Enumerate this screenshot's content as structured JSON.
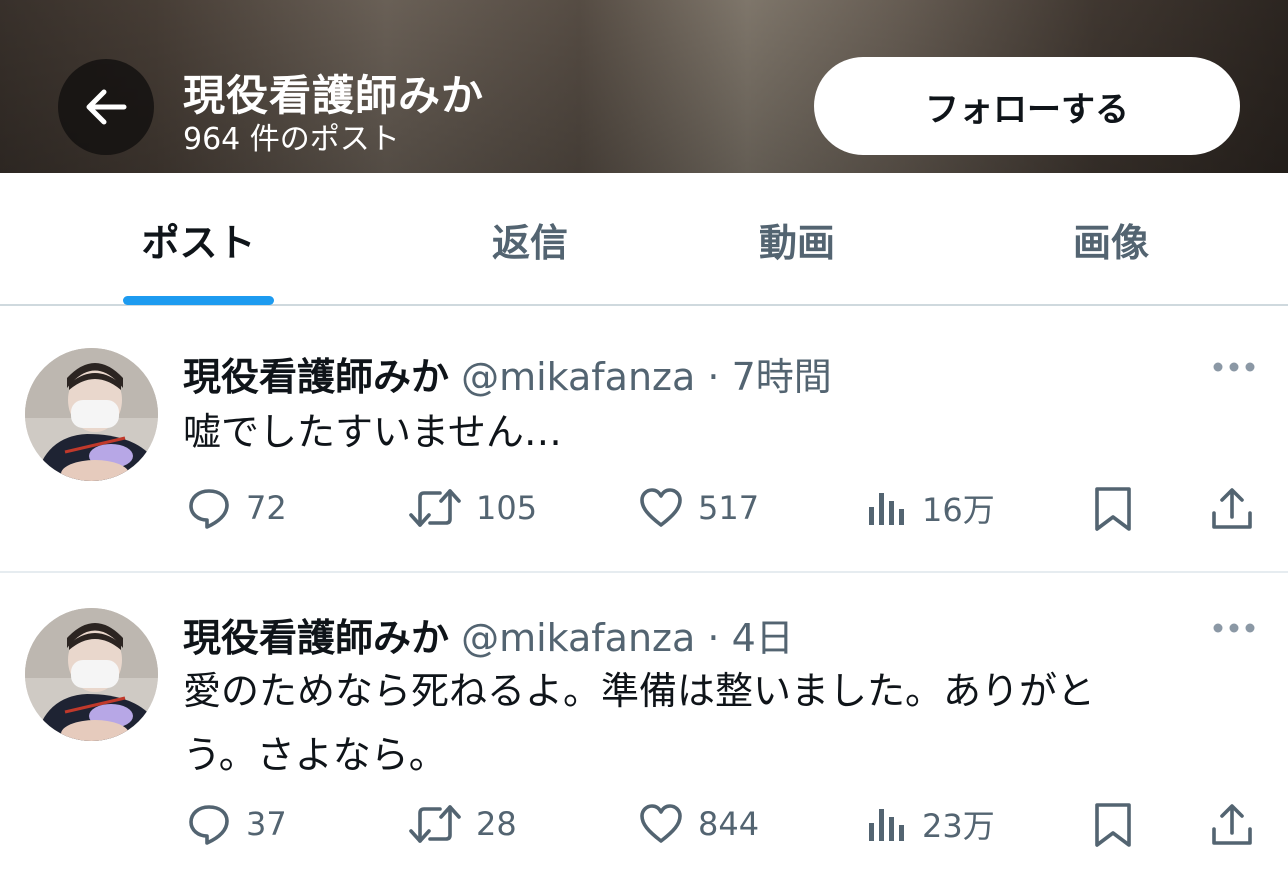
{
  "header": {
    "name": "現役看護師みか",
    "post_count": "964 件のポスト",
    "follow_label": "フォローする"
  },
  "tabs": [
    {
      "label": "ポスト",
      "active": true
    },
    {
      "label": "返信",
      "active": false
    },
    {
      "label": "動画",
      "active": false
    },
    {
      "label": "画像",
      "active": false
    }
  ],
  "posts": [
    {
      "name": "現役看護師みか",
      "handle": "@mikafanza",
      "separator": "·",
      "time": "7時間",
      "text_lines": [
        "嘘でしたすいません…"
      ],
      "replies": "72",
      "reposts": "105",
      "likes": "517",
      "views": "16万"
    },
    {
      "name": "現役看護師みか",
      "handle": "@mikafanza",
      "separator": "·",
      "time": "4日",
      "text_lines": [
        "愛のためなら死ねるよ。準備は整いました。ありがと",
        "う。さよなら。"
      ],
      "replies": "37",
      "reposts": "28",
      "likes": "844",
      "views": "23万"
    }
  ],
  "icons": {
    "back": "arrow-left-icon",
    "more": "more-horizontal-icon",
    "reply": "speech-bubble-icon",
    "repost": "repost-icon",
    "like": "heart-icon",
    "views": "bar-chart-icon",
    "bookmark": "bookmark-icon",
    "share": "share-icon"
  },
  "colors": {
    "accent": "#1d9bf0",
    "text_primary": "#0f1419",
    "text_secondary": "#536471"
  }
}
